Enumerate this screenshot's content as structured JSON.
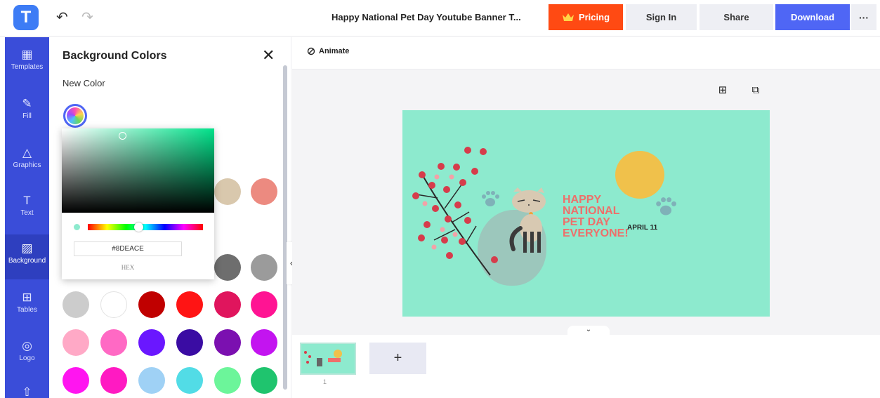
{
  "topbar": {
    "logo_letter": "T",
    "undo_icon": "↶",
    "redo_icon": "↷",
    "document_title": "Happy National Pet Day Youtube Banner T...",
    "pricing_label": "Pricing",
    "sign_in_label": "Sign In",
    "share_label": "Share",
    "download_label": "Download",
    "more_label": "···"
  },
  "sidebar": {
    "items": [
      {
        "label": "Templates",
        "icon": "▦"
      },
      {
        "label": "Fill",
        "icon": "✎"
      },
      {
        "label": "Graphics",
        "icon": "△"
      },
      {
        "label": "Text",
        "icon": "T"
      },
      {
        "label": "Background",
        "icon": "▨"
      },
      {
        "label": "Tables",
        "icon": "⊞"
      },
      {
        "label": "Logo",
        "icon": "◎"
      }
    ]
  },
  "panel": {
    "title": "Background Colors",
    "close_icon": "✕",
    "new_color_label": "New Color"
  },
  "picker": {
    "hex_value": "#8DEACE",
    "hex_label": "HEX",
    "hue_level": 0.44
  },
  "swatches": {
    "row1": [
      "#d9c8ad",
      "#ec8a80"
    ],
    "row2": [
      "#6e6e6e",
      "#9b9b9b"
    ],
    "row3": [
      "#cccccc",
      "#ffffff",
      "#c00000",
      "#ff1414",
      "#e0155d",
      "#ff1493"
    ],
    "row4": [
      "#ffa9c6",
      "#ff69c4",
      "#6a17ff",
      "#3a0ca3",
      "#7b10b0",
      "#c314f0"
    ],
    "row5": [
      "#ff15f0",
      "#ff1ac2",
      "#9fd1f5",
      "#52dce6",
      "#6cf59a",
      "#1fc46e"
    ]
  },
  "workspace": {
    "animate_label": "Animate",
    "add_element_icon": "⊞",
    "duplicate_icon": "⧉",
    "collapse_panel_icon": "‹",
    "collapse_pages_icon": "⌄",
    "page_number": "1",
    "add_page_icon": "+"
  },
  "canvas": {
    "background_color": "#8DEACE",
    "headline_lines": [
      "HAPPY",
      "NATIONAL",
      "PET DAY",
      "EVERYONE!"
    ],
    "date_text": "APRIL 11"
  }
}
